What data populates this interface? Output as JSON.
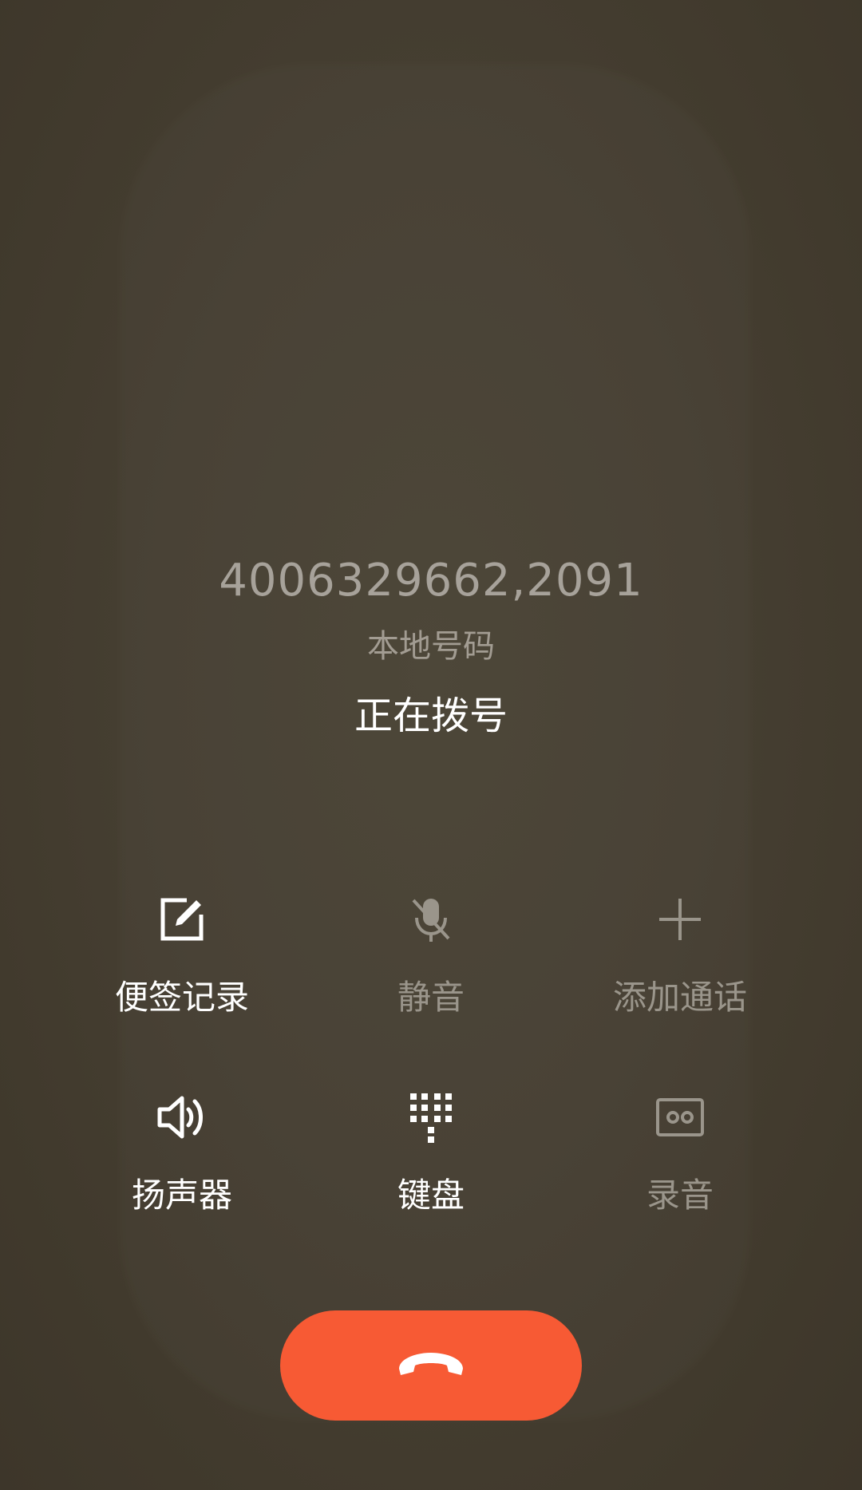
{
  "caller": {
    "number": "4006329662,2091",
    "location": "本地号码",
    "status": "正在拨号"
  },
  "controls": [
    {
      "label": "便签记录",
      "icon": "note-edit-icon",
      "enabled": true
    },
    {
      "label": "静音",
      "icon": "mic-off-icon",
      "enabled": false
    },
    {
      "label": "添加通话",
      "icon": "plus-icon",
      "enabled": false
    },
    {
      "label": "扬声器",
      "icon": "speaker-icon",
      "enabled": true
    },
    {
      "label": "键盘",
      "icon": "dialpad-icon",
      "enabled": true
    },
    {
      "label": "录音",
      "icon": "voicemail-record-icon",
      "enabled": false
    }
  ],
  "end_call": {
    "icon": "end-call-icon"
  },
  "colors": {
    "background": "#463f32",
    "end_call": "#f75a34",
    "enabled_text": "#ffffff",
    "disabled_text": "#9a958b",
    "number_text": "#a7a29a"
  }
}
